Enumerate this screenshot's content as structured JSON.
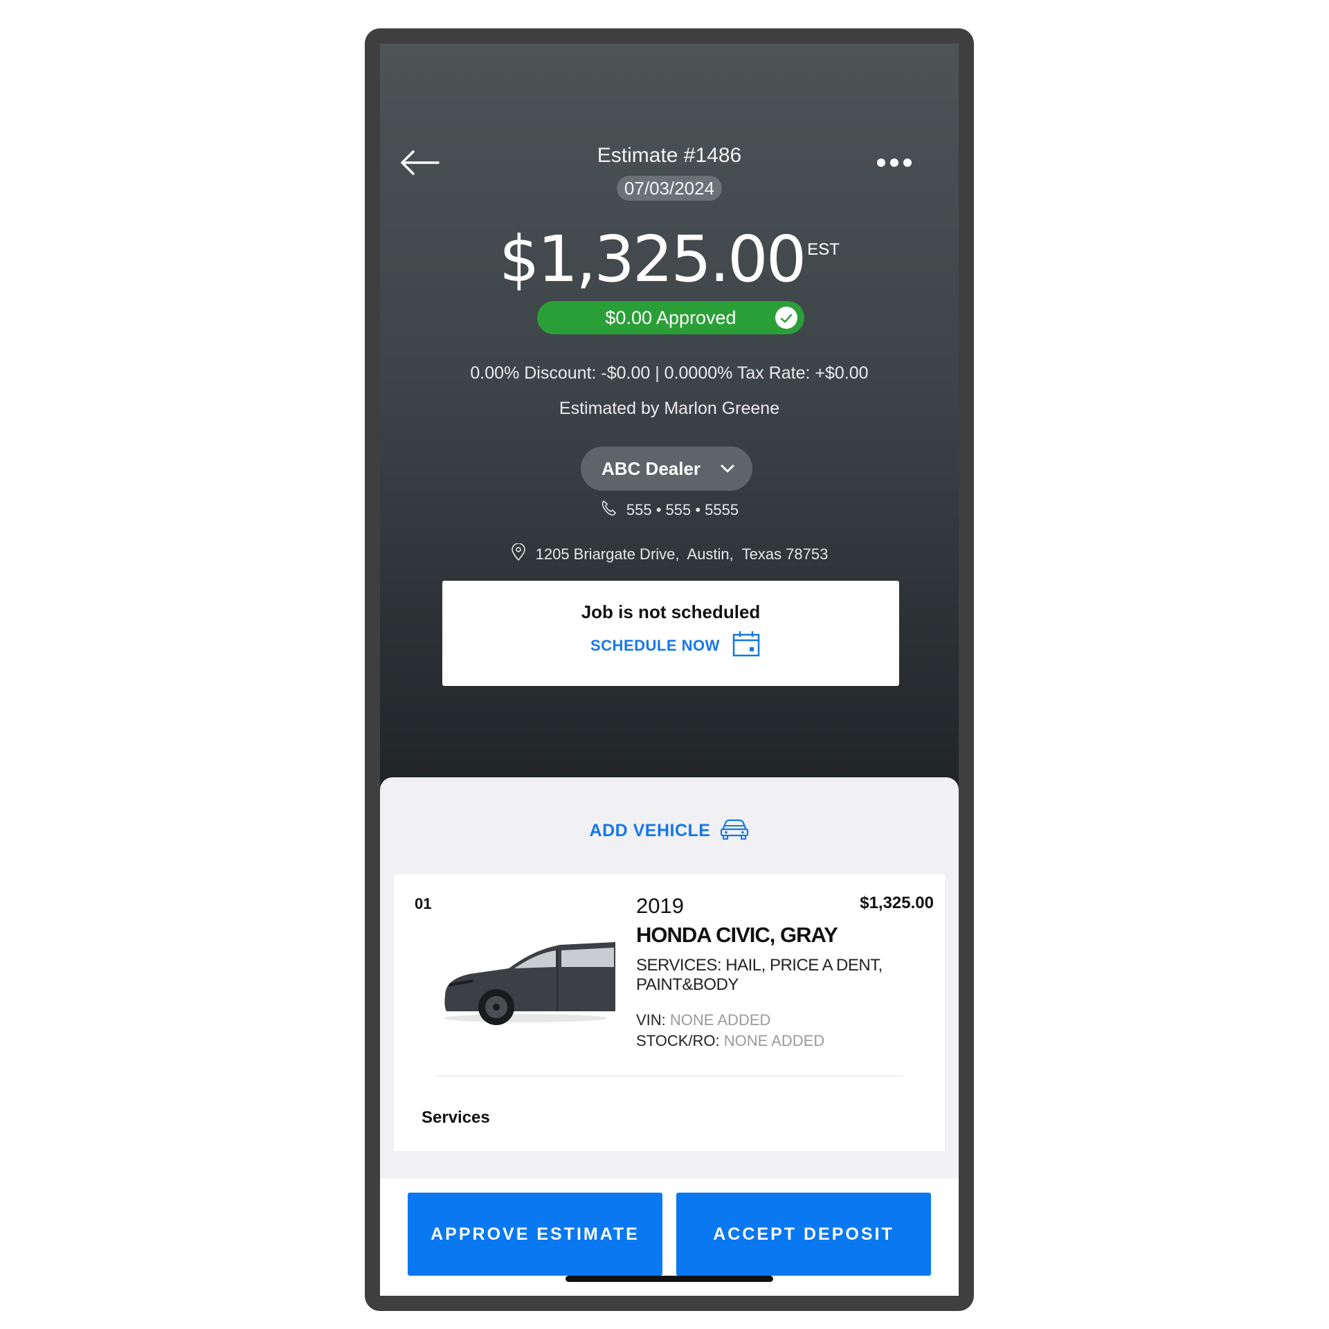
{
  "header": {
    "title": "Estimate #1486",
    "date": "07/03/2024",
    "amount": "$1,325.00",
    "amount_suffix": "EST",
    "approved_label": "$0.00 Approved",
    "discount_line": "0.00% Discount: -$0.00 | 0.0000% Tax Rate: +$0.00",
    "estimated_by": "Estimated by Marlon Greene"
  },
  "dealer": {
    "name": "ABC Dealer",
    "phone": "555 • 555 • 5555",
    "address": "1205 Briargate Drive,  Austin,  Texas 78753"
  },
  "schedule": {
    "status": "Job is not scheduled",
    "link_label": "SCHEDULE NOW"
  },
  "vehicles": {
    "add_label": "ADD VEHICLE",
    "items": [
      {
        "index": "01",
        "year": "2019",
        "name": "HONDA CIVIC, GRAY",
        "services": "SERVICES: HAIL, PRICE A DENT, PAINT&BODY",
        "price": "$1,325.00",
        "vin_label": "VIN:",
        "vin_value": "NONE ADDED",
        "stock_label": "STOCK/RO:",
        "stock_value": "NONE ADDED",
        "section_label": "Services"
      }
    ]
  },
  "actions": {
    "approve_label": "APPROVE ESTIMATE",
    "deposit_label": "ACCEPT DEPOSIT"
  },
  "colors": {
    "accent": "#0a78f0",
    "approved_green": "#2b9f37",
    "header_dark": "#3d4447"
  },
  "icons": [
    "back-arrow-icon",
    "more-dots-icon",
    "check-icon",
    "chevron-down-icon",
    "phone-icon",
    "location-pin-icon",
    "calendar-icon",
    "car-icon"
  ]
}
